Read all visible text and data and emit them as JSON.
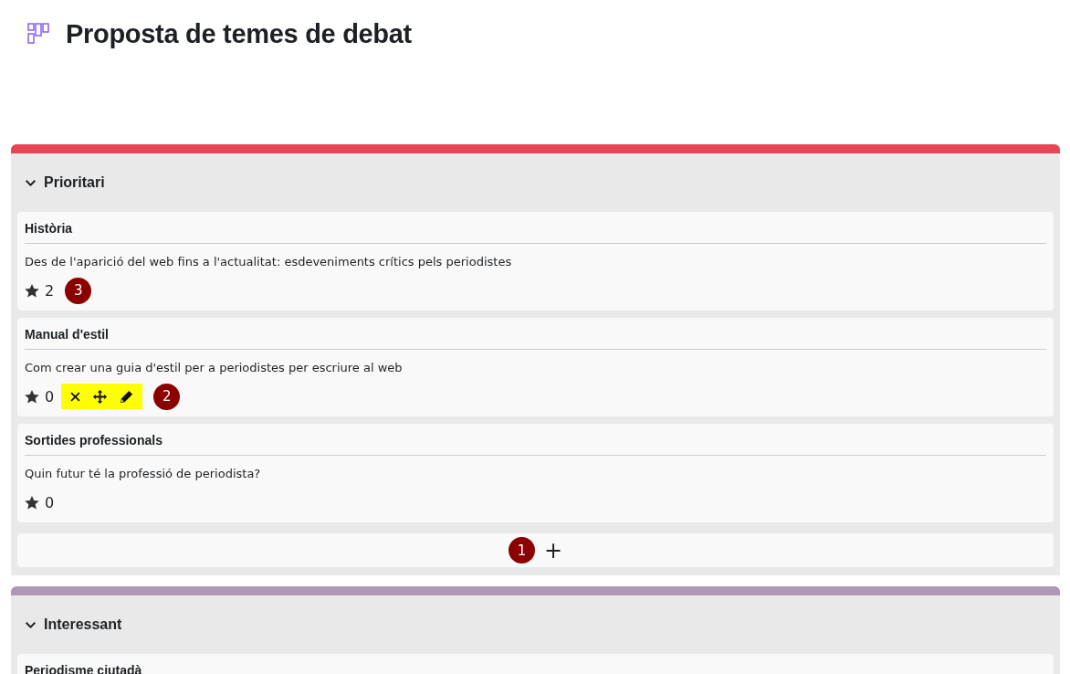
{
  "title": "Proposta de temes de debat",
  "columns": [
    {
      "name": "Prioritari",
      "color": "#e64555",
      "expanded": true,
      "cards": [
        {
          "title": "Història",
          "description": "Des de l'aparició del web fins a l'actualitat: esdeveniments crítics pels periodistes",
          "votes": "2",
          "actions_shown": false,
          "callout": "3"
        },
        {
          "title": "Manual d'estil",
          "description": "Com crear una guia d'estil per a periodistes per escriure al web",
          "votes": "0",
          "actions_shown": true,
          "callout": "2"
        },
        {
          "title": "Sortides professionals",
          "description": "Quin futur té la professió de periodista?",
          "votes": "0",
          "actions_shown": false
        }
      ],
      "add_button": {
        "label": "+",
        "callout": "1"
      }
    },
    {
      "name": "Interessant",
      "color": "#ae99b5",
      "expanded": true,
      "cards": [
        {
          "title": "Periodisme ciutadà"
        }
      ]
    }
  ]
}
